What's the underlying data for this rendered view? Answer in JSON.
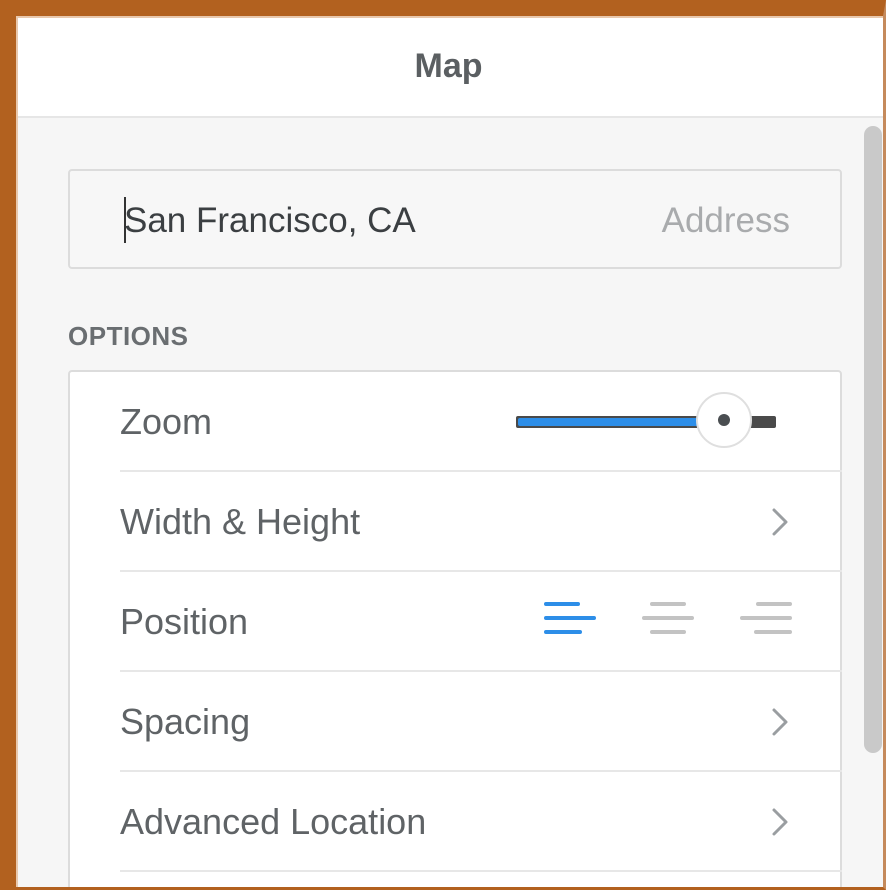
{
  "panel": {
    "title": "Map"
  },
  "address": {
    "value": "San Francisco, CA",
    "placeholder": "Address"
  },
  "options": {
    "section_label": "OPTIONS",
    "rows": [
      {
        "label": "Zoom",
        "control": "slider",
        "slider_level": 0.8
      },
      {
        "label": "Width & Height",
        "control": "chevron-right-icon"
      },
      {
        "label": "Position",
        "control": "alignment",
        "selected": "left"
      },
      {
        "label": "Spacing",
        "control": "chevron-right-icon"
      },
      {
        "label": "Advanced Location",
        "control": "chevron-right-icon"
      }
    ]
  },
  "colors": {
    "accent": "#2d8ee8",
    "inactive_icon": "#c3c3c3",
    "frame": "#b2611f"
  }
}
